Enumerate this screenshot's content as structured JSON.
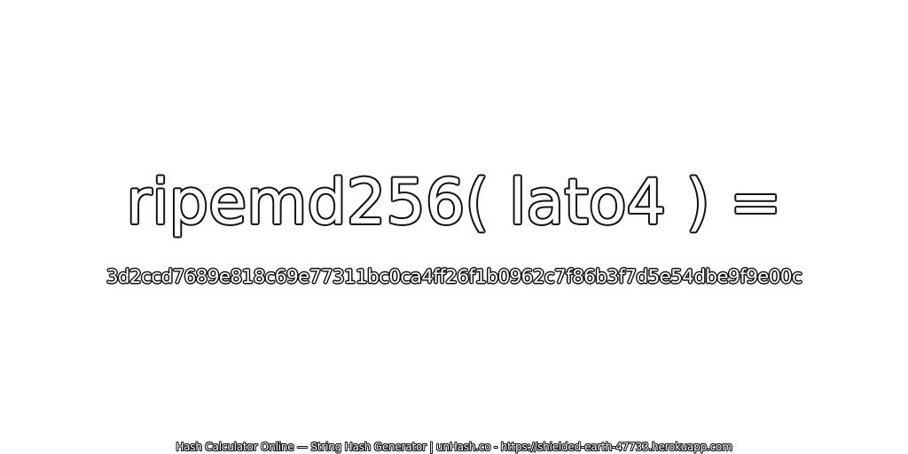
{
  "heading": "ripemd256( lato4 ) =",
  "hash_value": "3d2ccd7689e818c69e77311bc0ca4ff26f1b0962c7f86b3f7d5e54dbe9f9e00c",
  "footer": "Hash Calculator Online — String Hash Generator | unHash.co - https://shielded-earth-47733.herokuapp.com"
}
